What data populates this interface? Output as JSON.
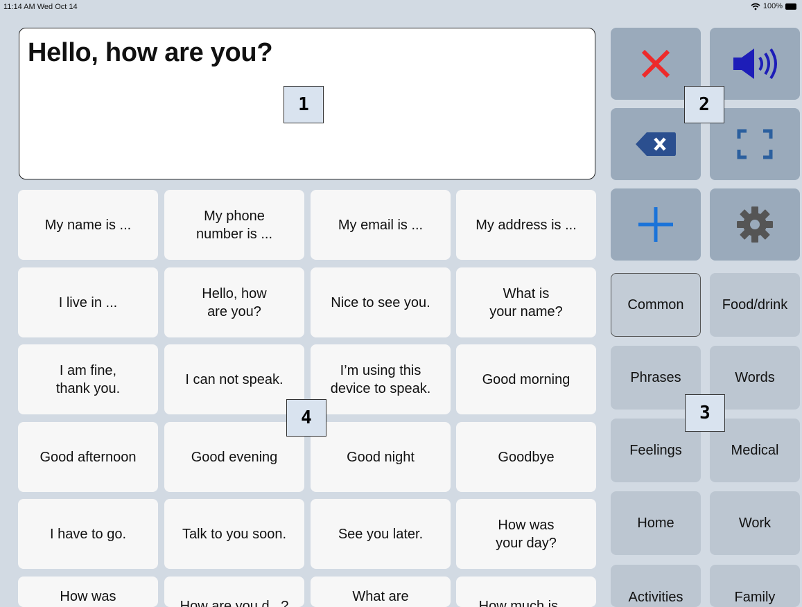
{
  "status": {
    "time": "11:14 AM  Wed Oct 14",
    "battery": "100%"
  },
  "message": {
    "text": "Hello, how are you?"
  },
  "phrases": [
    "My name is ...",
    "My phone\nnumber is ...",
    "My email is ...",
    "My address is ...",
    "I live in ...",
    "Hello, how\nare you?",
    "Nice to see you.",
    "What is\nyour name?",
    "I am fine,\nthank you.",
    "I can not speak.",
    "I’m using this\ndevice to speak.",
    "Good morning",
    "Good afternoon",
    "Good evening",
    "Good night",
    "Goodbye",
    "I have to go.",
    "Talk to you soon.",
    "See you later.",
    "How was\nyour day?",
    "How was",
    "How are you d...?",
    "What are",
    "How much is ..."
  ],
  "controls": {
    "clear_icon": "close-x-icon",
    "speak_icon": "speaker-icon",
    "backspace_icon": "backspace-icon",
    "fullscreen_icon": "fullscreen-icon",
    "add_icon": "plus-icon",
    "settings_icon": "gear-icon"
  },
  "categories": [
    {
      "label": "Common",
      "selected": true
    },
    {
      "label": "Food/drink",
      "selected": false
    },
    {
      "label": "Phrases",
      "selected": false
    },
    {
      "label": "Words",
      "selected": false
    },
    {
      "label": "Feelings",
      "selected": false
    },
    {
      "label": "Medical",
      "selected": false
    },
    {
      "label": "Home",
      "selected": false
    },
    {
      "label": "Work",
      "selected": false
    },
    {
      "label": "Activities",
      "selected": false
    },
    {
      "label": "Family",
      "selected": false
    }
  ],
  "markers": [
    "1",
    "2",
    "3",
    "4"
  ],
  "colors": {
    "background": "#d2dae3",
    "control_button": "#9aaabb",
    "category_button": "#bcc6d1",
    "clear_red": "#ee2a2a",
    "speaker_blue": "#1d1db8",
    "plus_blue": "#1a73d9",
    "backspace_blue": "#2b4f8f"
  }
}
